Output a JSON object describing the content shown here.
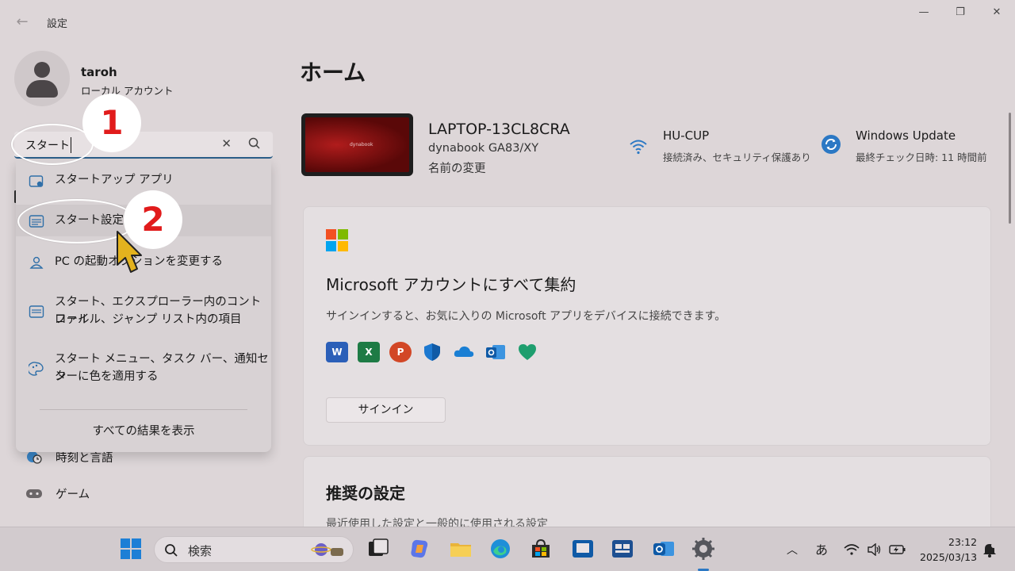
{
  "window": {
    "title": "設定",
    "controls": {
      "minimize": "—",
      "maximize": "❐",
      "close": "✕"
    }
  },
  "user": {
    "name": "taroh",
    "account_type": "ローカル アカウント"
  },
  "search": {
    "value": "スタート",
    "results": [
      {
        "label": "スタートアップ アプリ",
        "icon": "startup-apps-icon"
      },
      {
        "label": "スタート設定",
        "icon": "start-settings-icon"
      },
      {
        "label": "PC の起動オプションを変更する",
        "icon": "startup-options-icon"
      },
      {
        "label_line1": "スタート、エクスプローラー内のコントロール",
        "label_line2": "ファイル、ジャンプ リスト内の項目",
        "icon": "start-list-icon"
      },
      {
        "label_line1": "スタート メニュー、タスク バー、通知セン",
        "label_line2": "ターに色を適用する",
        "icon": "palette-icon"
      }
    ],
    "show_all": "すべての結果を表示"
  },
  "left_nav": [
    {
      "label": "時刻と言語",
      "icon": "globe-clock-icon"
    },
    {
      "label": "ゲーム",
      "icon": "gamepad-icon"
    }
  ],
  "main": {
    "title": "ホーム",
    "device": {
      "name": "LAPTOP-13CL8CRA",
      "model": "dynabook GA83/XY",
      "rename": "名前の変更",
      "brand": "dynabook"
    },
    "network": {
      "title": "HU-CUP",
      "subtitle": "接続済み、セキュリティ保護あり"
    },
    "update": {
      "title": "Windows Update",
      "subtitle": "最終チェック日時: 11 時間前"
    },
    "ms_card": {
      "title": "Microsoft アカウントにすべて集約",
      "description": "サインインすると、お気に入りの Microsoft アプリをデバイスに接続できます。",
      "button": "サインイン",
      "apps": [
        "W",
        "X",
        "P"
      ]
    },
    "recommended": {
      "title": "推奨の設定",
      "description": "最近使用した設定と一般的に使用される設定"
    }
  },
  "annotations": {
    "step1": "1",
    "step2": "2"
  },
  "taskbar": {
    "search_placeholder": "検索",
    "ime": "あ",
    "time": "23:12",
    "date": "2025/03/13"
  },
  "colors": {
    "accent": "#2b78c4",
    "annotation_red": "#e11b1b"
  }
}
